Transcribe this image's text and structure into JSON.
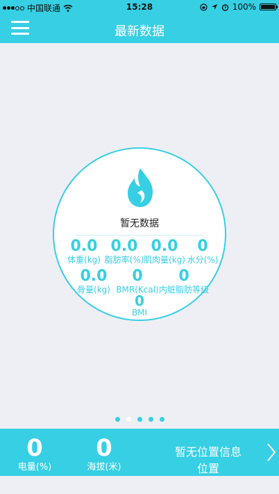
{
  "status_bar": {
    "carrier": "中国联通",
    "time": "15:28",
    "battery": "100%"
  },
  "nav": {
    "title": "最新数据"
  },
  "card": {
    "no_data_text": "暂无数据",
    "metrics": [
      {
        "value": "0.0",
        "label": "体重(kg)"
      },
      {
        "value": "0.0",
        "label": "脂肪率(%)"
      },
      {
        "value": "0.0",
        "label": "肌肉量(kg)"
      },
      {
        "value": "0",
        "label": "水分(%)"
      },
      {
        "value": "0.0",
        "label": "骨量(kg)"
      },
      {
        "value": "0",
        "label": "BMR(Kcal)"
      },
      {
        "value": "0",
        "label": "内脏脂肪等级"
      },
      {
        "value": "0",
        "label": "BMI"
      }
    ]
  },
  "pager": {
    "count": 5,
    "active_index": 1
  },
  "bottom": {
    "battery_value": "0",
    "battery_label": "电量(%)",
    "altitude_value": "0",
    "altitude_label": "海拔(米)",
    "location_info": "暂无位置信息",
    "location_label": "位置"
  },
  "colors": {
    "accent": "#36cfe3",
    "background": "#eeeff4"
  }
}
